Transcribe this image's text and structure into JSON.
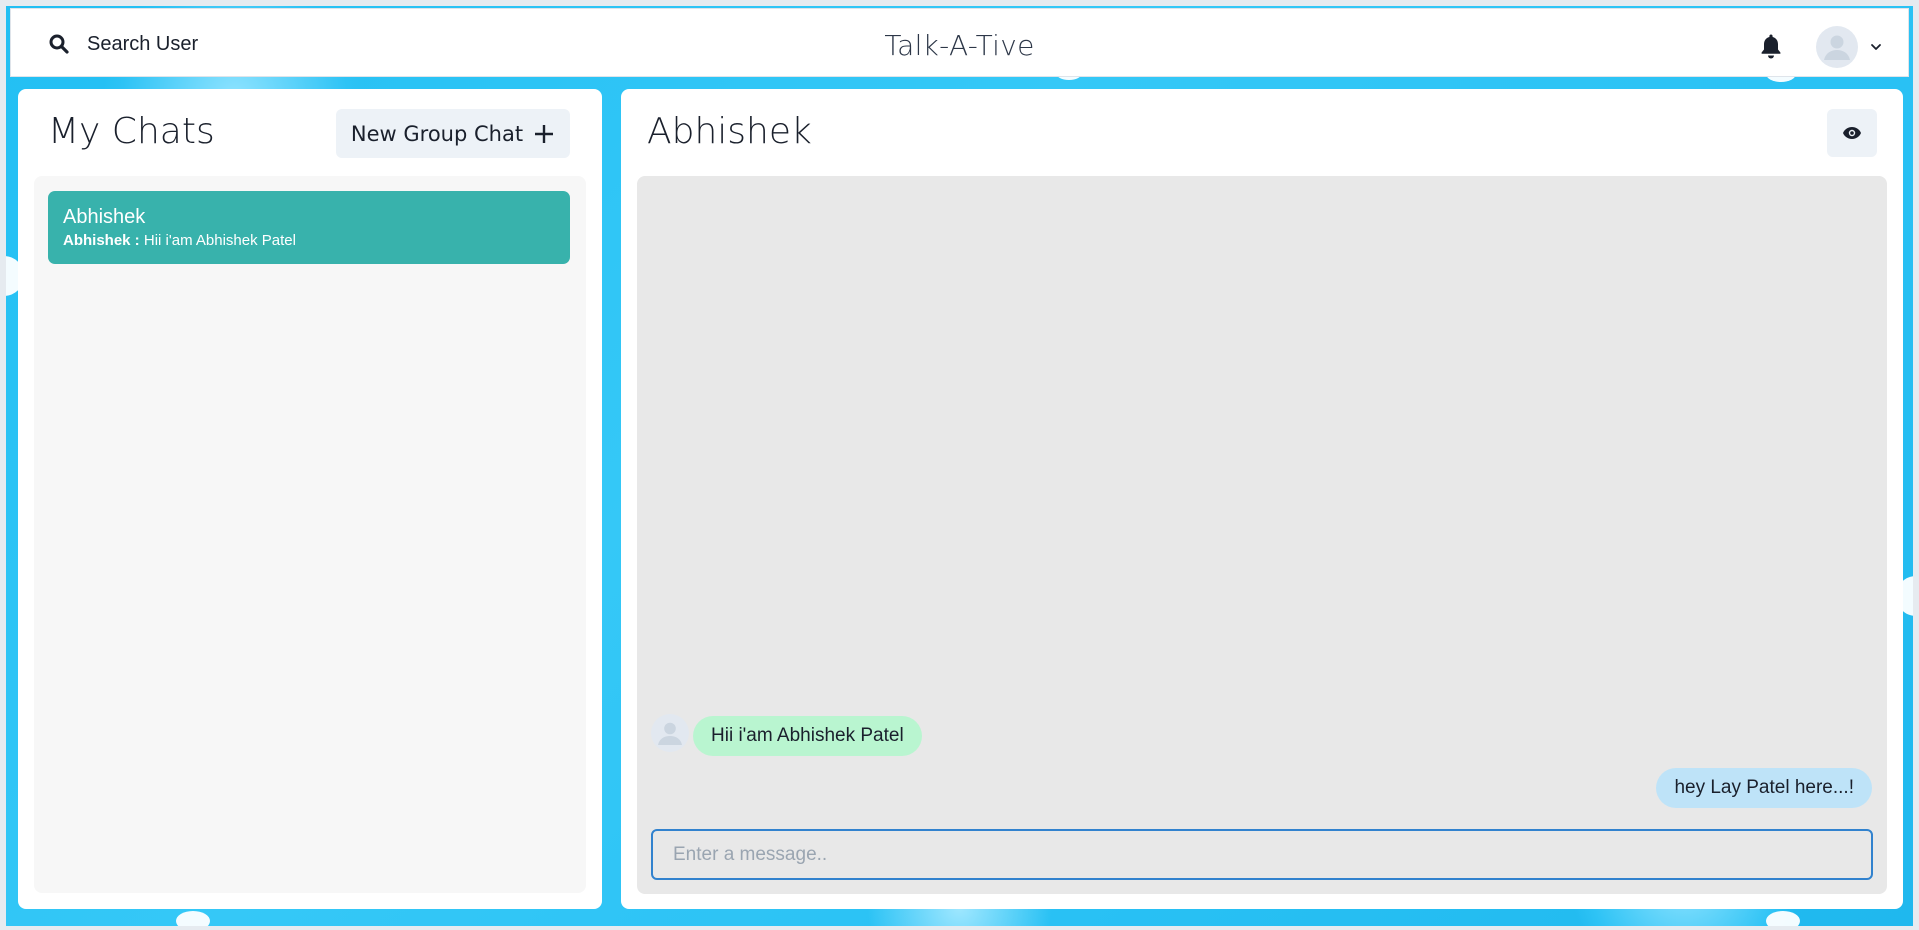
{
  "header": {
    "search_label": "Search User",
    "app_title": "Talk-A-Tive",
    "icons": {
      "search": "search-icon",
      "bell": "bell-icon",
      "avatar": "user-avatar-icon",
      "chevron": "chevron-down-icon"
    }
  },
  "sidebar": {
    "title": "My Chats",
    "new_group_label": "New Group Chat",
    "chats": [
      {
        "name": "Abhishek",
        "latest_sender": "Abhishek :",
        "latest_message": "Hii i'am Abhishek Patel",
        "selected": true
      }
    ]
  },
  "chat": {
    "title": "Abhishek",
    "messages": [
      {
        "text": "Hii i'am Abhishek Patel",
        "direction": "received"
      },
      {
        "text": "hey Lay Patel here...!",
        "direction": "sent"
      }
    ],
    "input": {
      "placeholder": "Enter a message..",
      "value": ""
    }
  },
  "colors": {
    "background": "#29c1f4",
    "selected_chat": "#38b2ac",
    "received_bubble": "#b9f5d0",
    "sent_bubble": "#bee3f8",
    "input_border": "#3182ce"
  }
}
